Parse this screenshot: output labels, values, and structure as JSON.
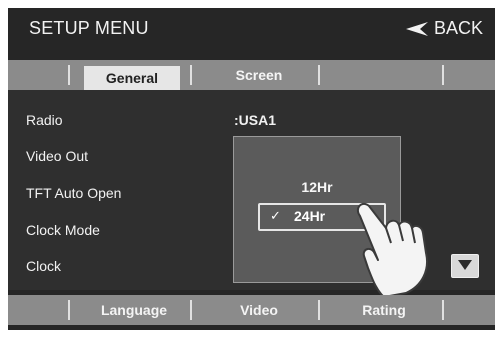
{
  "header": {
    "title": "SETUP MENU",
    "back_label": "BACK"
  },
  "top_tabs": [
    {
      "label": "General",
      "active": true
    },
    {
      "label": "Screen",
      "active": false
    }
  ],
  "settings": [
    {
      "label": "Radio",
      "value": ":USA1"
    },
    {
      "label": "Video Out"
    },
    {
      "label": "TFT Auto Open"
    },
    {
      "label": "Clock Mode"
    },
    {
      "label": "Clock"
    }
  ],
  "clock_mode_popup": {
    "options": [
      "12Hr",
      "24Hr"
    ],
    "selected": "24Hr",
    "check_glyph": "✓"
  },
  "bottom_tabs": [
    {
      "label": "Language"
    },
    {
      "label": "Video"
    },
    {
      "label": "Rating"
    }
  ],
  "icons": {
    "back": "back-arrow-icon",
    "scroll_down": "down-triangle-icon",
    "pointer": "pointing-hand-icon"
  },
  "colors": {
    "screen_bg": "#262626",
    "tab_bar_bg": "#8b8b8b",
    "active_tab_bg": "#e6e6e6",
    "popup_bg": "#5b5b5b",
    "text": "#f2f2f2"
  }
}
